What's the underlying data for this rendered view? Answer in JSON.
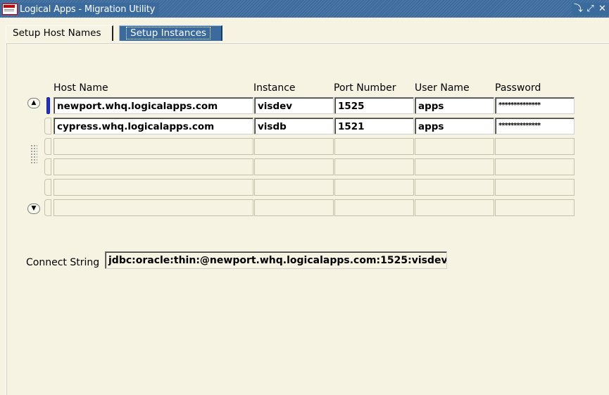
{
  "window": {
    "title": "Logical Apps - Migration Utility",
    "controls": [
      "⤵",
      "⤢",
      "✕"
    ]
  },
  "tabs": [
    {
      "label": "Setup Host Names",
      "active": true
    },
    {
      "label": "Setup Instances",
      "active": false
    }
  ],
  "grid": {
    "columns": [
      "Host Name",
      "Instance",
      "Port Number",
      "User Name",
      "Password"
    ],
    "rows": [
      {
        "host": "newport.whq.logicalapps.com",
        "instance": "visdev",
        "port": "1525",
        "user": "apps",
        "password": "**************",
        "current": true
      },
      {
        "host": "cypress.whq.logicalapps.com",
        "instance": "visdb",
        "port": "1521",
        "user": "apps",
        "password": "**************",
        "current": false
      },
      {
        "host": "",
        "instance": "",
        "port": "",
        "user": "",
        "password": "",
        "current": false
      },
      {
        "host": "",
        "instance": "",
        "port": "",
        "user": "",
        "password": "",
        "current": false
      },
      {
        "host": "",
        "instance": "",
        "port": "",
        "user": "",
        "password": "",
        "current": false
      },
      {
        "host": "",
        "instance": "",
        "port": "",
        "user": "",
        "password": "",
        "current": false
      }
    ],
    "scroll_up": "▲",
    "scroll_down": "▼"
  },
  "connect": {
    "label": "Connect String",
    "value": "jdbc:oracle:thin:@newport.whq.logicalapps.com:1525:visdev"
  },
  "colors": {
    "titlebar": "#3b6a9c",
    "background": "#f7f3e3",
    "record_indicator": "#2030c8"
  }
}
